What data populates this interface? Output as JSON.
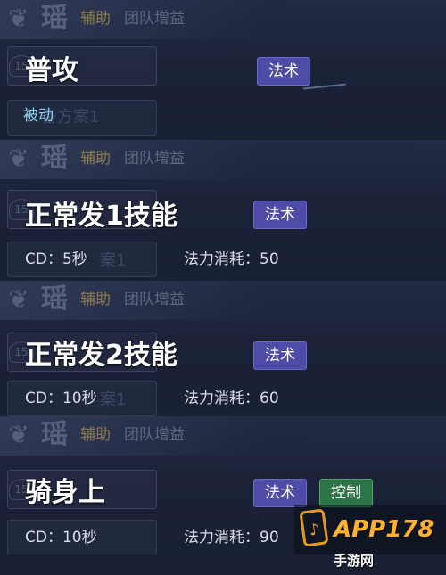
{
  "sections": [
    {
      "hero_glyph": "瑶",
      "role": "辅助",
      "team_buff": "团队增益",
      "skill_name": "普攻",
      "tags": [
        "法术"
      ],
      "level_badge": "15",
      "lower_ghost": "备方案1",
      "passive_label": "被动",
      "cd": "",
      "mana": ""
    },
    {
      "hero_glyph": "瑶",
      "role": "辅助",
      "team_buff": "团队增益",
      "skill_name": "正常发1技能",
      "tags": [
        "法术"
      ],
      "level_badge": "15",
      "lower_ghost": "案1",
      "passive_label": "",
      "cd": "CD：5秒",
      "mana": "法力消耗：50"
    },
    {
      "hero_glyph": "瑶",
      "role": "辅助",
      "team_buff": "团队增益",
      "skill_name": "正常发2技能",
      "tags": [
        "法术"
      ],
      "level_badge": "15",
      "lower_ghost": "案1",
      "passive_label": "",
      "cd": "CD：10秒",
      "mana": "法力消耗：60"
    },
    {
      "hero_glyph": "瑶",
      "role": "辅助",
      "team_buff": "团队增益",
      "skill_name": "骑身上",
      "tags": [
        "法术",
        "控制"
      ],
      "level_badge": "15",
      "lower_ghost": "",
      "passive_label": "",
      "cd": "CD：10秒",
      "mana": "法力消耗：90"
    }
  ],
  "watermark": {
    "brand": "APP178",
    "suffix": "手游网",
    "icon": "phone-icon"
  },
  "colors": {
    "background": "#1a2033",
    "tag_magic": "#4e4ca6",
    "tag_control": "#2b7445",
    "role_text": "#8f7a4b",
    "passive_text": "#8fd2f3"
  }
}
